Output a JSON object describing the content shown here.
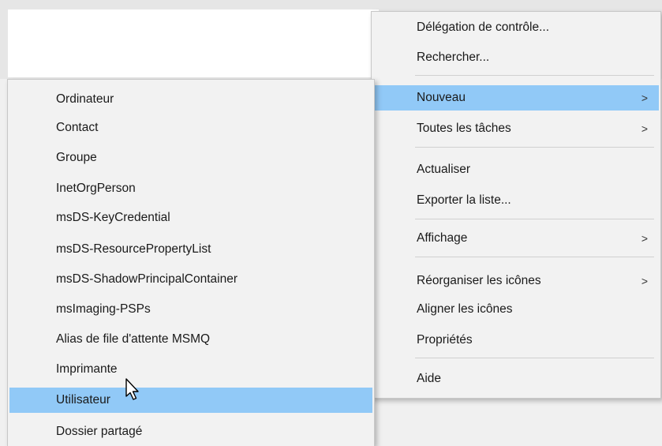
{
  "context_menu": {
    "items": [
      {
        "label": "Délégation de contrôle..."
      },
      {
        "label": "Rechercher..."
      },
      {
        "label": "Nouveau"
      },
      {
        "label": "Toutes les tâches"
      },
      {
        "label": "Actualiser"
      },
      {
        "label": "Exporter la liste..."
      },
      {
        "label": "Affichage"
      },
      {
        "label": "Réorganiser les icônes"
      },
      {
        "label": "Aligner les icônes"
      },
      {
        "label": "Propriétés"
      },
      {
        "label": "Aide"
      }
    ],
    "submenu_arrow": ">"
  },
  "submenu": {
    "items": [
      {
        "label": "Ordinateur"
      },
      {
        "label": "Contact"
      },
      {
        "label": "Groupe"
      },
      {
        "label": "InetOrgPerson"
      },
      {
        "label": "msDS-KeyCredential"
      },
      {
        "label": "msDS-ResourcePropertyList"
      },
      {
        "label": "msDS-ShadowPrincipalContainer"
      },
      {
        "label": "msImaging-PSPs"
      },
      {
        "label": "Alias de file d'attente MSMQ"
      },
      {
        "label": "Imprimante"
      },
      {
        "label": "Utilisateur"
      },
      {
        "label": "Dossier partagé"
      }
    ]
  },
  "colors": {
    "menu_background": "#f2f2f2",
    "highlight": "#91c9f7",
    "separator": "#d0d0d0"
  },
  "icons": [
    "chevron-right-icon",
    "mouse-pointer-icon"
  ]
}
